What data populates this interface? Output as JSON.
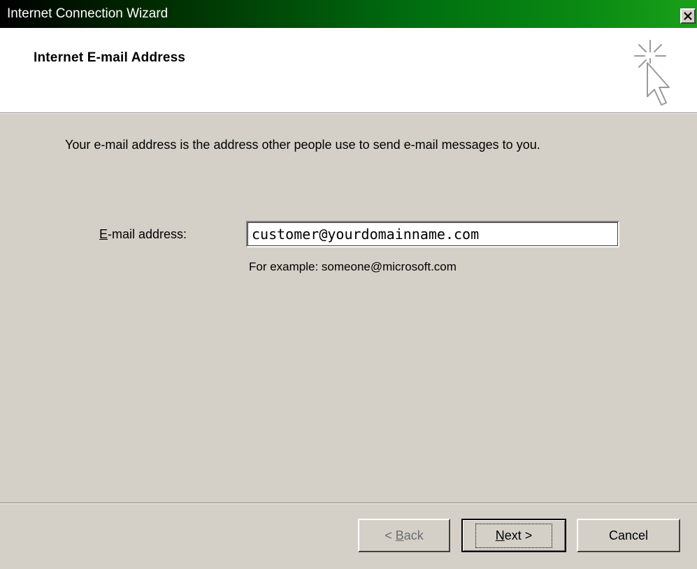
{
  "window": {
    "title": "Internet Connection Wizard",
    "close_icon": "close-icon",
    "title_gradient": [
      "#000000",
      "#006f10",
      "#1aa11a"
    ]
  },
  "header": {
    "title": "Internet E-mail Address",
    "icon": "wizard-sparkle-cursor-icon"
  },
  "body": {
    "intro": "Your e-mail address is the address other people use to send e-mail messages to you.",
    "email_label_mnemonic": "E",
    "email_label_rest": "-mail address:",
    "email_value": "customer@yourdomainname.com",
    "example": "For example: someone@microsoft.com"
  },
  "footer": {
    "back_prefix": "< ",
    "back_mnemonic": "B",
    "back_rest": "ack",
    "next_mnemonic": "N",
    "next_rest": "ext >",
    "cancel_label": "Cancel"
  }
}
